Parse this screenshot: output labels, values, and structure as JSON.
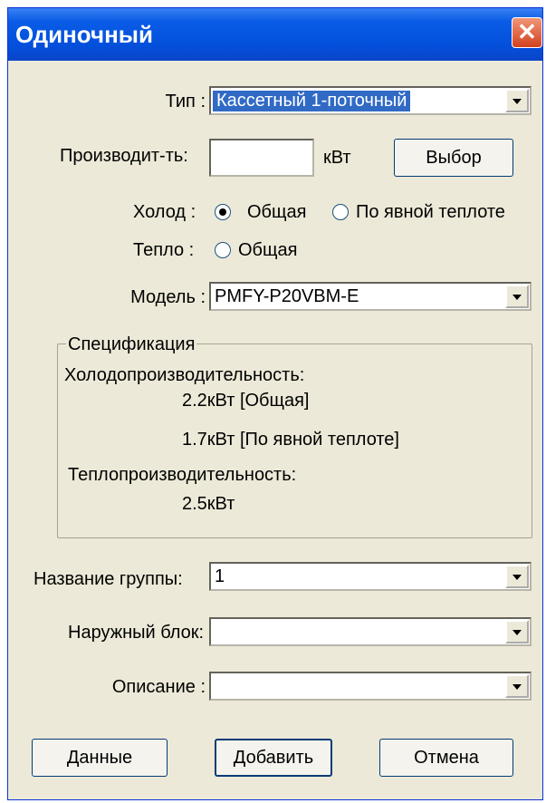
{
  "window": {
    "title": "Одиночный"
  },
  "type_row": {
    "label": "Тип :",
    "value": "Кассетный 1-поточный"
  },
  "capacity_row": {
    "label": "Производит-ть:",
    "value": "",
    "unit": "кВт",
    "select_button": "Выбор"
  },
  "cooling_row": {
    "label": "Холод :",
    "options": [
      "Общая",
      "По явной теплоте"
    ],
    "selected": "Общая"
  },
  "heating_row": {
    "label": "Тепло :",
    "options": [
      "Общая"
    ],
    "selected": ""
  },
  "model_row": {
    "label": "Модель :",
    "value": "PMFY-P20VBM-E"
  },
  "specification": {
    "title": "Спецификация",
    "cooling_capacity_label": "Холодопроизводительность:",
    "cooling_total": "2.2кВт [Общая]",
    "cooling_sensible": "1.7кВт [По явной теплоте]",
    "heating_capacity_label": "Теплопроизводительность:",
    "heating_total": "2.5кВт"
  },
  "group_row": {
    "label": "Название группы:",
    "value": "1"
  },
  "outdoor_row": {
    "label": "Наружный блок:",
    "value": ""
  },
  "description_row": {
    "label": "Описание :",
    "value": ""
  },
  "buttons": {
    "data": "Данные",
    "add": "Добавить",
    "cancel": "Отмена"
  }
}
